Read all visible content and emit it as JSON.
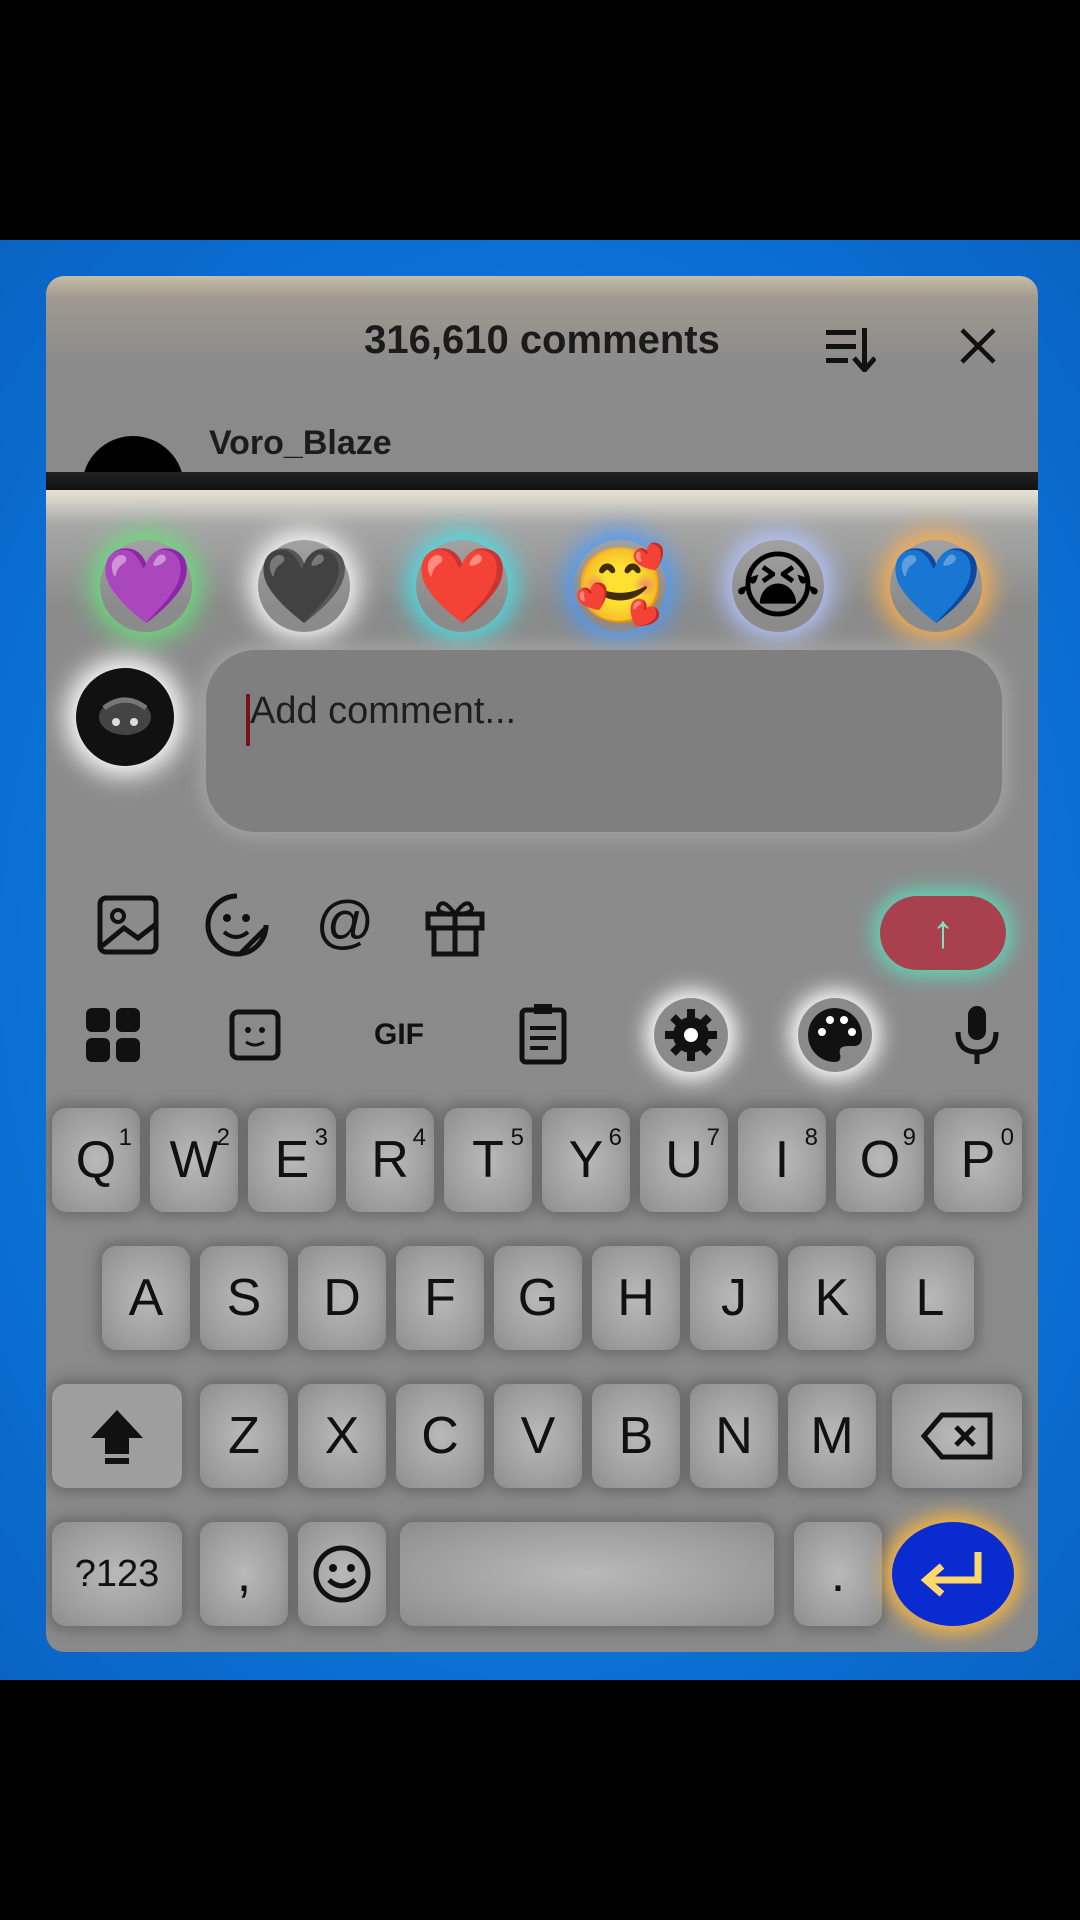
{
  "header": {
    "title": "316,610 comments",
    "comment_user": "Voro_Blaze"
  },
  "reactions": [
    "💜",
    "🖤",
    "❤️",
    "🥰",
    "😭",
    "💙"
  ],
  "input": {
    "placeholder": "Add comment..."
  },
  "tools": [
    "image-icon",
    "sticker-emoji-icon",
    "mention-icon",
    "gift-icon"
  ],
  "send": {
    "label": "↑"
  },
  "keyboard_toolbar": {
    "gif": "GIF"
  },
  "keyboard": {
    "row1": [
      {
        "k": "Q",
        "n": "1"
      },
      {
        "k": "W",
        "n": "2"
      },
      {
        "k": "E",
        "n": "3"
      },
      {
        "k": "R",
        "n": "4"
      },
      {
        "k": "T",
        "n": "5"
      },
      {
        "k": "Y",
        "n": "6"
      },
      {
        "k": "U",
        "n": "7"
      },
      {
        "k": "I",
        "n": "8"
      },
      {
        "k": "O",
        "n": "9"
      },
      {
        "k": "P",
        "n": "0"
      }
    ],
    "row2": [
      "A",
      "S",
      "D",
      "F",
      "G",
      "H",
      "J",
      "K",
      "L"
    ],
    "row3": [
      "Z",
      "X",
      "C",
      "V",
      "B",
      "N",
      "M"
    ],
    "sym": "?123",
    "comma": ",",
    "period": "."
  },
  "colors": {
    "send_bg": "#a9404e",
    "enter_bg": "#0a2bd0",
    "frame": "#0b74d8"
  }
}
